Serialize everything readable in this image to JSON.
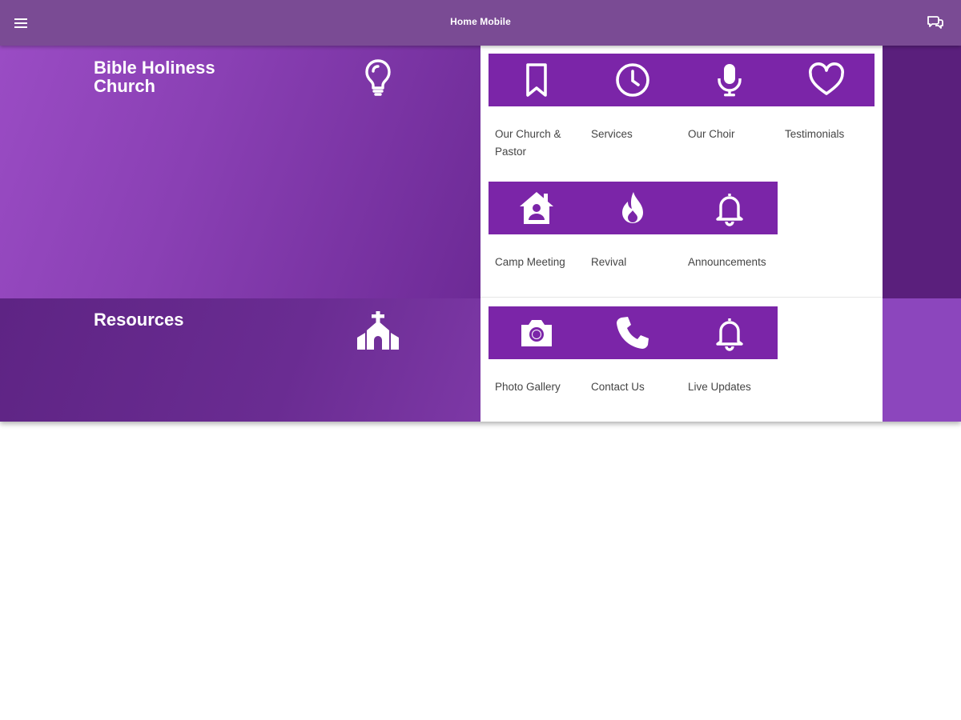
{
  "appbar": {
    "title": "Home Mobile",
    "menu_icon": "hamburger-menu-icon",
    "chat_icon": "chat-bubbles-icon",
    "background": "#7a4b94"
  },
  "panels": [
    {
      "title": "Bible Holiness Church",
      "icon": "lightbulb-icon"
    },
    {
      "title": "Resources",
      "icon": "church-building-icon"
    }
  ],
  "tiles": {
    "accent": "#7b25a8",
    "rows": [
      [
        {
          "label": "Our Church & Pastor",
          "icon": "bookmark-icon"
        },
        {
          "label": "Services",
          "icon": "clock-icon"
        },
        {
          "label": "Our Choir",
          "icon": "microphone-icon"
        },
        {
          "label": "Testimonials",
          "icon": "heart-icon"
        }
      ],
      [
        {
          "label": "Camp Meeting",
          "icon": "home-person-icon"
        },
        {
          "label": "Revival",
          "icon": "flame-icon"
        },
        {
          "label": "Announcements",
          "icon": "bell-icon"
        }
      ],
      [
        {
          "label": "Photo Gallery",
          "icon": "camera-icon"
        },
        {
          "label": "Contact Us",
          "icon": "phone-icon"
        },
        {
          "label": "Live Updates",
          "icon": "bell-icon"
        }
      ]
    ]
  }
}
